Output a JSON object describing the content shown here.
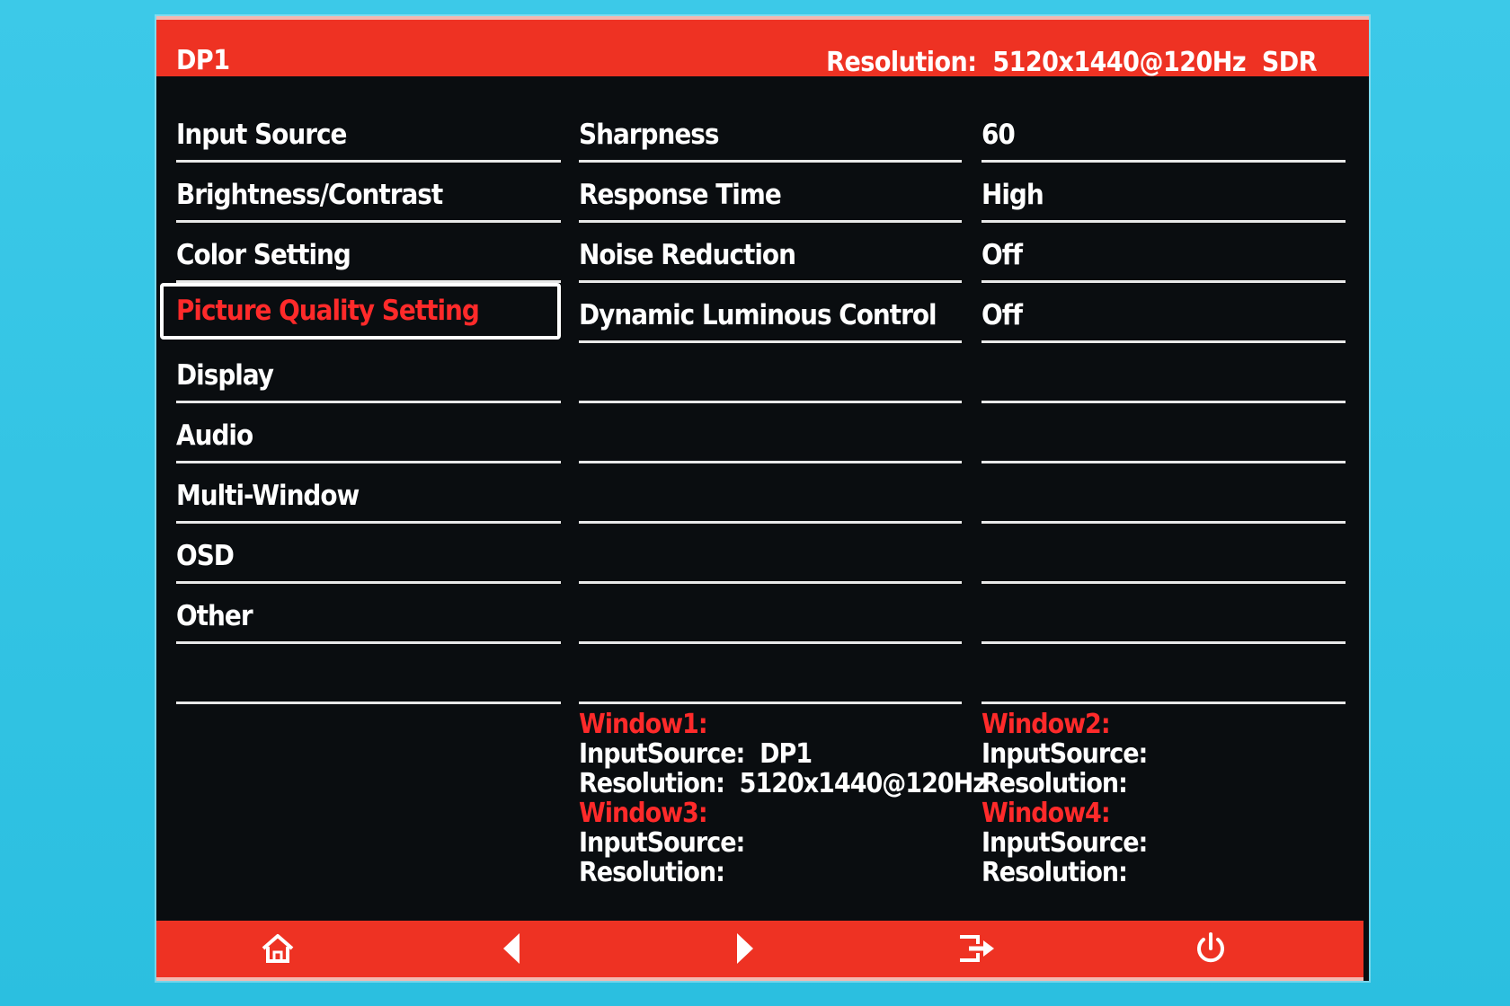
{
  "header": {
    "title": "DP1",
    "resolution": "Resolution:  5120x1440@120Hz  SDR"
  },
  "menu": {
    "items": [
      {
        "label": "Input Source"
      },
      {
        "label": "Brightness/Contrast"
      },
      {
        "label": "Color Setting"
      },
      {
        "label": "Picture Quality Setting",
        "selected": true
      },
      {
        "label": "Display"
      },
      {
        "label": "Audio"
      },
      {
        "label": "Multi-Window"
      },
      {
        "label": "OSD"
      },
      {
        "label": "Other"
      },
      {
        "label": ""
      }
    ]
  },
  "settings": {
    "names": [
      "Sharpness",
      "Response Time",
      "Noise Reduction",
      "Dynamic Luminous Control",
      "",
      "",
      "",
      "",
      "",
      ""
    ],
    "values": [
      "60",
      "High",
      "Off",
      "Off",
      "",
      "",
      "",
      "",
      "",
      ""
    ]
  },
  "windows": {
    "w1": {
      "title": "Window1:",
      "input": "InputSource:  DP1",
      "resolution": "Resolution:  5120x1440@120Hz"
    },
    "w2": {
      "title": "Window2:",
      "input": "InputSource:",
      "resolution": "Resolution:"
    },
    "w3": {
      "title": "Window3:",
      "input": "InputSource:",
      "resolution": "Resolution:"
    },
    "w4": {
      "title": "Window4:",
      "input": "InputSource:",
      "resolution": "Resolution:"
    }
  },
  "footer": {
    "icons": [
      "home-icon",
      "left-arrow-icon",
      "right-arrow-icon",
      "exit-icon",
      "power-icon"
    ]
  },
  "colors": {
    "accent": "#ee3223",
    "selected_text": "#ff2a2a",
    "background": "#0a0d10",
    "screen": "#2fc3e3"
  }
}
